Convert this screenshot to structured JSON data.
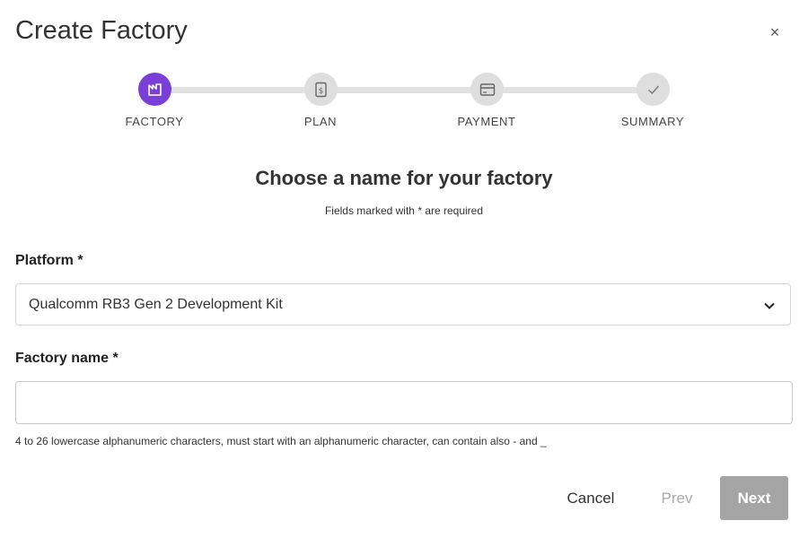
{
  "dialog": {
    "title": "Create Factory",
    "close_label": "×"
  },
  "stepper": {
    "active_color": "#7a3fd6",
    "inactive_color": "#dedede",
    "steps": [
      {
        "label": "FACTORY",
        "icon": "factory-icon",
        "state": "active"
      },
      {
        "label": "PLAN",
        "icon": "dollar-document-icon",
        "state": "inactive"
      },
      {
        "label": "PAYMENT",
        "icon": "credit-card-icon",
        "state": "inactive"
      },
      {
        "label": "SUMMARY",
        "icon": "check-icon",
        "state": "inactive"
      }
    ]
  },
  "form": {
    "heading": "Choose a name for your factory",
    "subheading": "Fields marked with * are required",
    "platform": {
      "label": "Platform *",
      "selected": "Qualcomm RB3 Gen 2 Development Kit"
    },
    "factory_name": {
      "label": "Factory name *",
      "value": "",
      "hint": "4 to 26 lowercase alphanumeric characters, must start with an alphanumeric character, can contain also - and _"
    }
  },
  "actions": {
    "cancel_label": "Cancel",
    "prev_label": "Prev",
    "next_label": "Next"
  }
}
